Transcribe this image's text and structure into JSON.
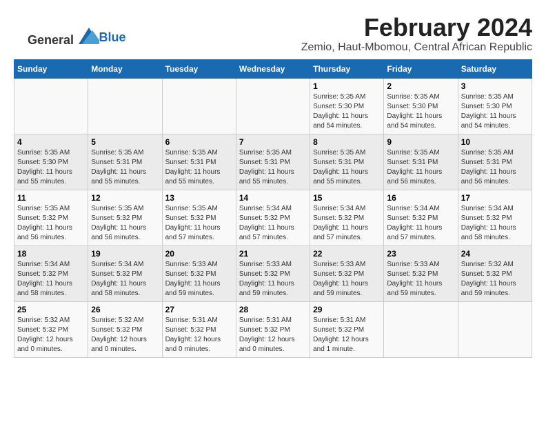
{
  "logo": {
    "text_general": "General",
    "text_blue": "Blue"
  },
  "header": {
    "month_year": "February 2024",
    "location": "Zemio, Haut-Mbomou, Central African Republic"
  },
  "weekdays": [
    "Sunday",
    "Monday",
    "Tuesday",
    "Wednesday",
    "Thursday",
    "Friday",
    "Saturday"
  ],
  "weeks": [
    [
      {
        "day": "",
        "info": ""
      },
      {
        "day": "",
        "info": ""
      },
      {
        "day": "",
        "info": ""
      },
      {
        "day": "",
        "info": ""
      },
      {
        "day": "1",
        "info": "Sunrise: 5:35 AM\nSunset: 5:30 PM\nDaylight: 11 hours\nand 54 minutes."
      },
      {
        "day": "2",
        "info": "Sunrise: 5:35 AM\nSunset: 5:30 PM\nDaylight: 11 hours\nand 54 minutes."
      },
      {
        "day": "3",
        "info": "Sunrise: 5:35 AM\nSunset: 5:30 PM\nDaylight: 11 hours\nand 54 minutes."
      }
    ],
    [
      {
        "day": "4",
        "info": "Sunrise: 5:35 AM\nSunset: 5:30 PM\nDaylight: 11 hours\nand 55 minutes."
      },
      {
        "day": "5",
        "info": "Sunrise: 5:35 AM\nSunset: 5:31 PM\nDaylight: 11 hours\nand 55 minutes."
      },
      {
        "day": "6",
        "info": "Sunrise: 5:35 AM\nSunset: 5:31 PM\nDaylight: 11 hours\nand 55 minutes."
      },
      {
        "day": "7",
        "info": "Sunrise: 5:35 AM\nSunset: 5:31 PM\nDaylight: 11 hours\nand 55 minutes."
      },
      {
        "day": "8",
        "info": "Sunrise: 5:35 AM\nSunset: 5:31 PM\nDaylight: 11 hours\nand 55 minutes."
      },
      {
        "day": "9",
        "info": "Sunrise: 5:35 AM\nSunset: 5:31 PM\nDaylight: 11 hours\nand 56 minutes."
      },
      {
        "day": "10",
        "info": "Sunrise: 5:35 AM\nSunset: 5:31 PM\nDaylight: 11 hours\nand 56 minutes."
      }
    ],
    [
      {
        "day": "11",
        "info": "Sunrise: 5:35 AM\nSunset: 5:32 PM\nDaylight: 11 hours\nand 56 minutes."
      },
      {
        "day": "12",
        "info": "Sunrise: 5:35 AM\nSunset: 5:32 PM\nDaylight: 11 hours\nand 56 minutes."
      },
      {
        "day": "13",
        "info": "Sunrise: 5:35 AM\nSunset: 5:32 PM\nDaylight: 11 hours\nand 57 minutes."
      },
      {
        "day": "14",
        "info": "Sunrise: 5:34 AM\nSunset: 5:32 PM\nDaylight: 11 hours\nand 57 minutes."
      },
      {
        "day": "15",
        "info": "Sunrise: 5:34 AM\nSunset: 5:32 PM\nDaylight: 11 hours\nand 57 minutes."
      },
      {
        "day": "16",
        "info": "Sunrise: 5:34 AM\nSunset: 5:32 PM\nDaylight: 11 hours\nand 57 minutes."
      },
      {
        "day": "17",
        "info": "Sunrise: 5:34 AM\nSunset: 5:32 PM\nDaylight: 11 hours\nand 58 minutes."
      }
    ],
    [
      {
        "day": "18",
        "info": "Sunrise: 5:34 AM\nSunset: 5:32 PM\nDaylight: 11 hours\nand 58 minutes."
      },
      {
        "day": "19",
        "info": "Sunrise: 5:34 AM\nSunset: 5:32 PM\nDaylight: 11 hours\nand 58 minutes."
      },
      {
        "day": "20",
        "info": "Sunrise: 5:33 AM\nSunset: 5:32 PM\nDaylight: 11 hours\nand 59 minutes."
      },
      {
        "day": "21",
        "info": "Sunrise: 5:33 AM\nSunset: 5:32 PM\nDaylight: 11 hours\nand 59 minutes."
      },
      {
        "day": "22",
        "info": "Sunrise: 5:33 AM\nSunset: 5:32 PM\nDaylight: 11 hours\nand 59 minutes."
      },
      {
        "day": "23",
        "info": "Sunrise: 5:33 AM\nSunset: 5:32 PM\nDaylight: 11 hours\nand 59 minutes."
      },
      {
        "day": "24",
        "info": "Sunrise: 5:32 AM\nSunset: 5:32 PM\nDaylight: 11 hours\nand 59 minutes."
      }
    ],
    [
      {
        "day": "25",
        "info": "Sunrise: 5:32 AM\nSunset: 5:32 PM\nDaylight: 12 hours\nand 0 minutes."
      },
      {
        "day": "26",
        "info": "Sunrise: 5:32 AM\nSunset: 5:32 PM\nDaylight: 12 hours\nand 0 minutes."
      },
      {
        "day": "27",
        "info": "Sunrise: 5:31 AM\nSunset: 5:32 PM\nDaylight: 12 hours\nand 0 minutes."
      },
      {
        "day": "28",
        "info": "Sunrise: 5:31 AM\nSunset: 5:32 PM\nDaylight: 12 hours\nand 0 minutes."
      },
      {
        "day": "29",
        "info": "Sunrise: 5:31 AM\nSunset: 5:32 PM\nDaylight: 12 hours\nand 1 minute."
      },
      {
        "day": "",
        "info": ""
      },
      {
        "day": "",
        "info": ""
      }
    ]
  ]
}
